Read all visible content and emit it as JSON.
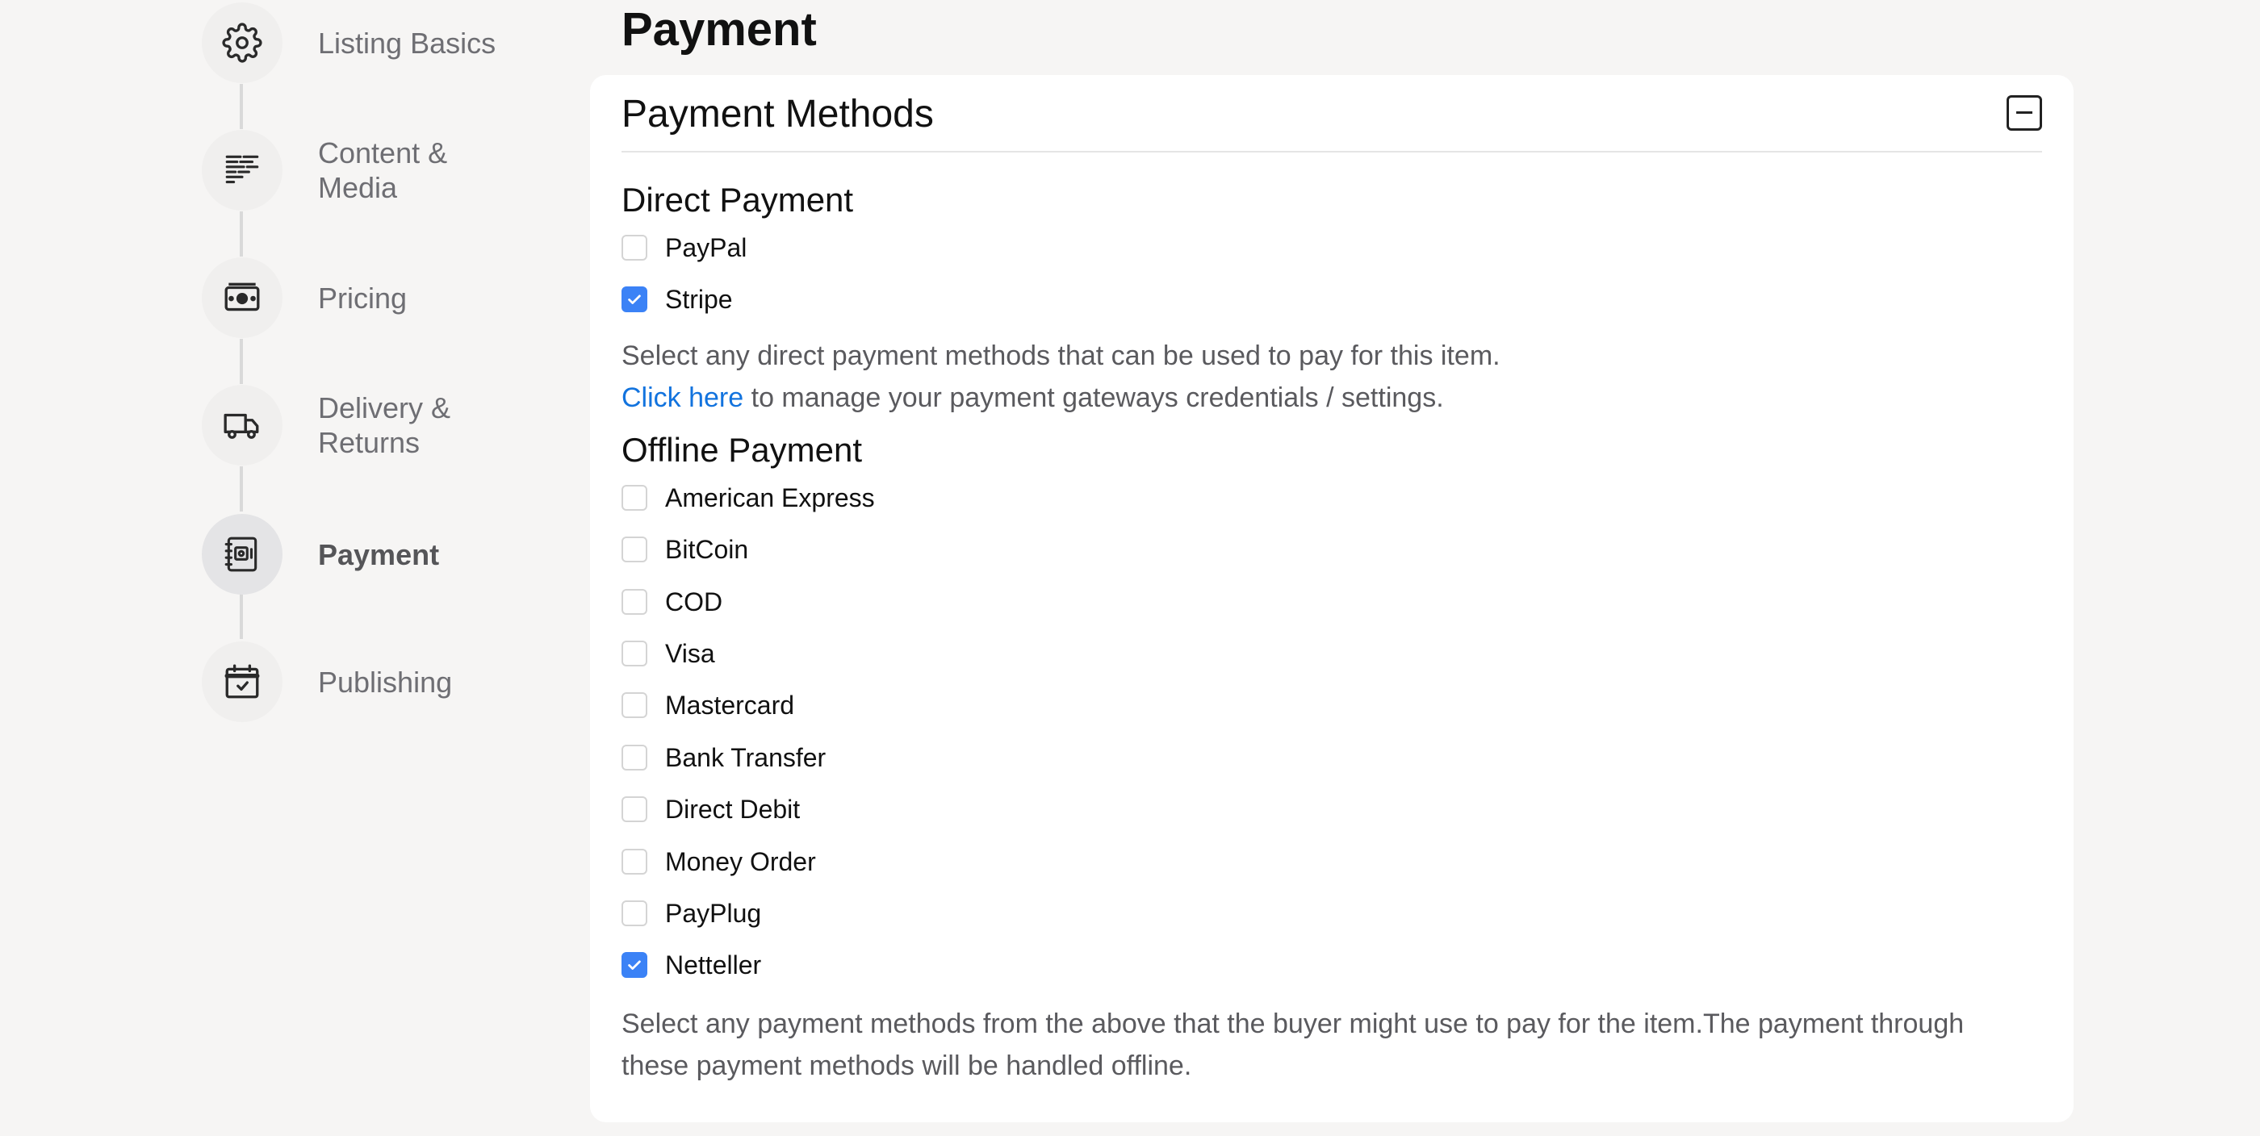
{
  "sidebar": {
    "steps": [
      {
        "label": "Listing Basics",
        "icon": "gear-icon"
      },
      {
        "label": "Content & Media",
        "icon": "text-align-icon"
      },
      {
        "label": "Pricing",
        "icon": "banknote-icon"
      },
      {
        "label": "Delivery & Returns",
        "icon": "truck-icon"
      },
      {
        "label": "Payment",
        "icon": "wallet-icon",
        "active": true
      },
      {
        "label": "Publishing",
        "icon": "calendar-check-icon"
      }
    ]
  },
  "page": {
    "title": "Payment"
  },
  "card": {
    "title": "Payment Methods",
    "collapse_icon": "minus-square-icon"
  },
  "direct": {
    "title": "Direct Payment",
    "options": [
      {
        "label": "PayPal",
        "checked": false
      },
      {
        "label": "Stripe",
        "checked": true
      }
    ],
    "help": "Select any direct payment methods that can be used to pay for this item.",
    "link_text": "Click here",
    "link_suffix": " to manage your payment gateways credentials / settings."
  },
  "offline": {
    "title": "Offline Payment",
    "options": [
      {
        "label": "American Express",
        "checked": false
      },
      {
        "label": "BitCoin",
        "checked": false
      },
      {
        "label": "COD",
        "checked": false
      },
      {
        "label": "Visa",
        "checked": false
      },
      {
        "label": "Mastercard",
        "checked": false
      },
      {
        "label": "Bank Transfer",
        "checked": false
      },
      {
        "label": "Direct Debit",
        "checked": false
      },
      {
        "label": "Money Order",
        "checked": false
      },
      {
        "label": "PayPlug",
        "checked": false
      },
      {
        "label": "Netteller",
        "checked": true
      }
    ],
    "help": "Select any payment methods from the above that the buyer might use to pay for the item.The payment through these payment methods will be handled offline."
  },
  "colors": {
    "accent": "#3b82f6",
    "link": "#1273de",
    "background": "#f6f5f4"
  }
}
